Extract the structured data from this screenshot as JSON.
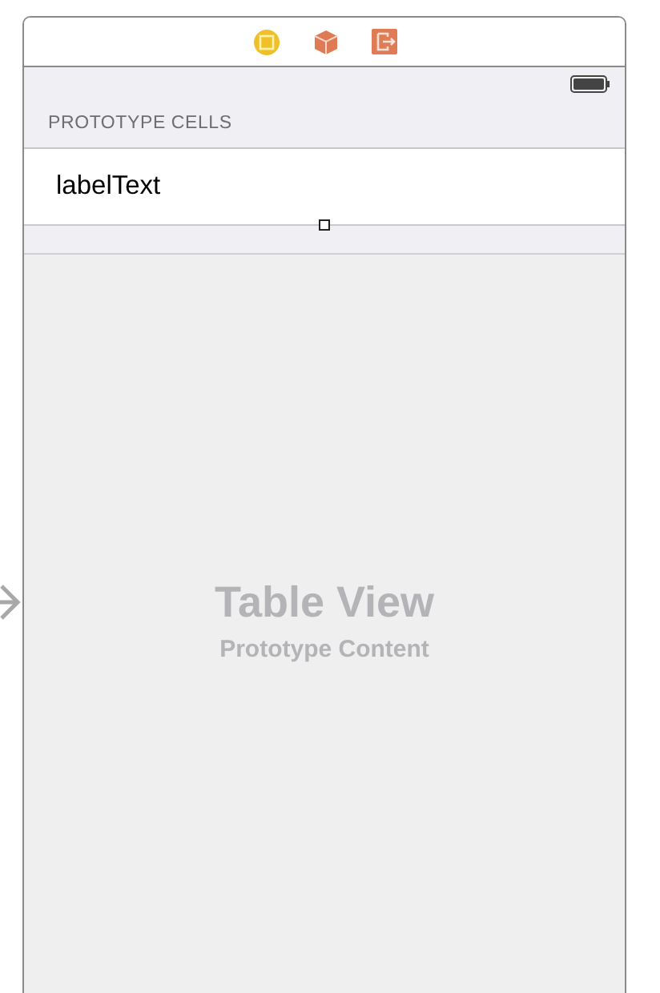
{
  "table": {
    "section_header": "PROTOTYPE CELLS",
    "cells": [
      {
        "label": "labelText"
      }
    ],
    "placeholder": {
      "title": "Table View",
      "subtitle": "Prototype Content"
    }
  }
}
